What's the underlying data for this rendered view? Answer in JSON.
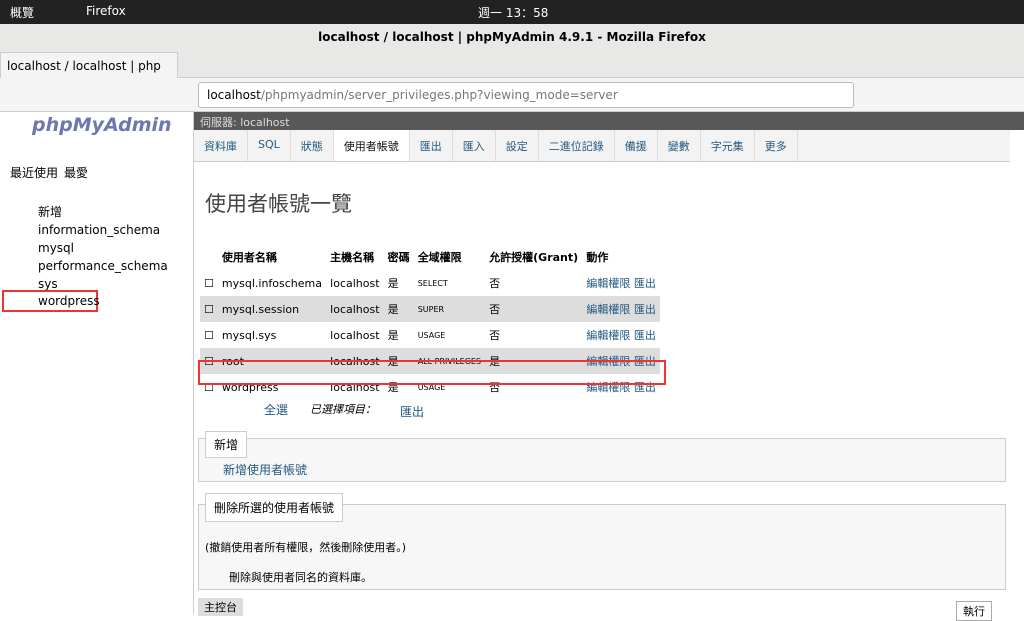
{
  "sys": {
    "overview": "概覽",
    "browser": "Firefox",
    "clock": "週一 13：58"
  },
  "window_title": "localhost / localhost | phpMyAdmin 4.9.1 - Mozilla Firefox",
  "tab": "localhost / localhost | php",
  "url": {
    "host": "localhost",
    "path": "/phpmyadmin/server_privileges.php?viewing_mode=server"
  },
  "logo": "phpMyAdmin",
  "side": {
    "recent": "最近使用",
    "fav": "最愛",
    "new": "新增",
    "dbs": [
      "information_schema",
      "mysql",
      "performance_schema",
      "sys",
      "wordpress"
    ]
  },
  "server": "伺服器: localhost",
  "menu": [
    "資料庫",
    "SQL",
    "狀態",
    "使用者帳號",
    "匯出",
    "匯入",
    "設定",
    "二進位記錄",
    "備援",
    "變數",
    "字元集",
    "更多"
  ],
  "title": "使用者帳號一覽",
  "cols": [
    "使用者名稱",
    "主機名稱",
    "密碼",
    "全域權限",
    "允許授權(Grant)",
    "動作"
  ],
  "rows": [
    [
      "mysql.infoschema",
      "localhost",
      "是",
      "SELECT",
      "否"
    ],
    [
      "mysql.session",
      "localhost",
      "是",
      "SUPER",
      "否"
    ],
    [
      "mysql.sys",
      "localhost",
      "是",
      "USAGE",
      "否"
    ],
    [
      "root",
      "localhost",
      "是",
      "ALL PRIVILEGES",
      "是"
    ],
    [
      "wordpress",
      "localhost",
      "是",
      "USAGE",
      "否"
    ]
  ],
  "edit": "編輯權限",
  "export": "匯出",
  "selall": "全選",
  "selected": "已選擇項目：",
  "new_legend": "新增",
  "add_user": "新增使用者帳號",
  "del_legend": "刪除所選的使用者帳號",
  "del_note": "(撤銷使用者所有權限，然後刪除使用者。)",
  "del_db": "刪除與使用者同名的資料庫。",
  "console": "主控台",
  "go": "執行"
}
